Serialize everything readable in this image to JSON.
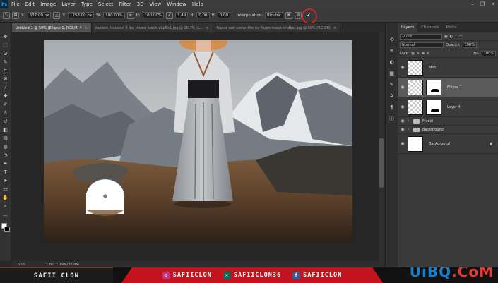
{
  "menu": [
    "File",
    "Edit",
    "Image",
    "Layer",
    "Type",
    "Select",
    "Filter",
    "3D",
    "View",
    "Window",
    "Help"
  ],
  "window_controls": [
    "–",
    "❐",
    "✕"
  ],
  "options": {
    "x_label": "X:",
    "x_value": "337.00 px",
    "y_label": "Y:",
    "y_value": "1258.00 px",
    "w_label": "W:",
    "w_value": "100.00%",
    "h_label": "H:",
    "h_value": "100.00%",
    "angle_value": "1.49",
    "hskew_label": "H:",
    "hskew_value": "0.00",
    "vskew_label": "V:",
    "vskew_value": "0.00",
    "interp_label": "Interpolation:",
    "interp_value": "Bicubic"
  },
  "doc_tabs": [
    {
      "label": "Untitled-1 @ 50% (Ellipse 1, RGB/8) *",
      "active": true
    },
    {
      "label": "eastern_hostess_5_by_mizzd_stock-d3p5x1.jpg @ 16.7% (L...",
      "active": false
    },
    {
      "label": "found_out_camp_fire_by_fagomstock-d4dboj.jpg @ 50% (RGB/8)",
      "active": false
    }
  ],
  "status": {
    "zoom": "50%",
    "doc": "Doc: 7.19M/35.8M"
  },
  "panel": {
    "tabs": [
      "Layers",
      "Channels",
      "Paths"
    ],
    "kind_label": "Kind",
    "blend_mode": "Normal",
    "opacity_label": "Opacity:",
    "opacity_value": "100%",
    "lock_label": "Lock:",
    "fill_label": "Fill:",
    "fill_value": "100%",
    "layers": [
      {
        "name": "Mist"
      },
      {
        "name": "Ellipse 1"
      },
      {
        "name": "Layer 4"
      }
    ],
    "groups": [
      {
        "name": "Model"
      },
      {
        "name": "Background"
      }
    ],
    "bg_layer": "Background"
  },
  "banner": {
    "channel": "SAFII CLON",
    "instagram": "SAFIICLON",
    "xing": "SAFIICLON36",
    "facebook": "SAFIICLON",
    "wm_a": "UiBQ",
    "wm_b": ".CoM"
  },
  "colors": {
    "accent": "#c4121e",
    "ps_blue": "#31a8ff"
  }
}
